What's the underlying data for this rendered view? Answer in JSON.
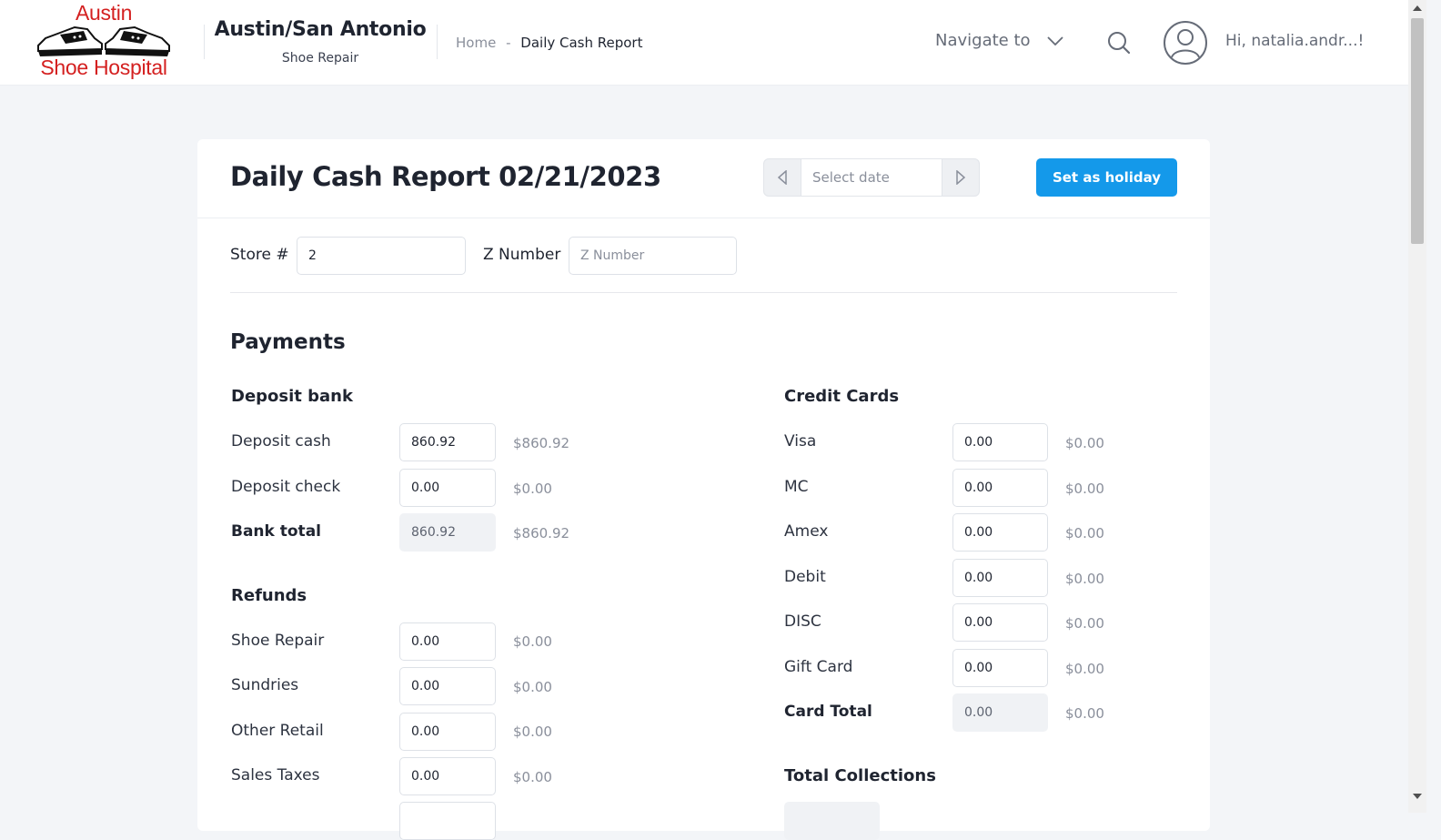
{
  "header": {
    "logo": {
      "line1": "Austin",
      "line2": "Shoe Hospital"
    },
    "brand_title": "Austin/San Antonio",
    "brand_subtitle": "Shoe Repair",
    "breadcrumb": {
      "home": "Home",
      "separator": "-",
      "current": "Daily Cash Report"
    },
    "navigate_label": "Navigate to",
    "greeting": "Hi, natalia.andr...!"
  },
  "report": {
    "title": "Daily Cash Report 02/21/2023",
    "date_placeholder": "Select date",
    "holiday_button": "Set as holiday",
    "store_label": "Store #",
    "store_value": "2",
    "z_label": "Z Number",
    "z_placeholder": "Z Number"
  },
  "payments": {
    "title": "Payments",
    "deposit_bank": {
      "title": "Deposit bank",
      "rows": [
        {
          "label": "Deposit cash",
          "value": "860.92",
          "amount": "$860.92"
        },
        {
          "label": "Deposit check",
          "value": "0.00",
          "amount": "$0.00"
        },
        {
          "label": "Bank total",
          "value": "860.92",
          "amount": "$860.92"
        }
      ]
    },
    "refunds": {
      "title": "Refunds",
      "rows": [
        {
          "label": "Shoe Repair",
          "value": "0.00",
          "amount": "$0.00"
        },
        {
          "label": "Sundries",
          "value": "0.00",
          "amount": "$0.00"
        },
        {
          "label": "Other Retail",
          "value": "0.00",
          "amount": "$0.00"
        },
        {
          "label": "Sales Taxes",
          "value": "0.00",
          "amount": "$0.00"
        }
      ]
    },
    "credit_cards": {
      "title": "Credit Cards",
      "rows": [
        {
          "label": "Visa",
          "value": "0.00",
          "amount": "$0.00"
        },
        {
          "label": "MC",
          "value": "0.00",
          "amount": "$0.00"
        },
        {
          "label": "Amex",
          "value": "0.00",
          "amount": "$0.00"
        },
        {
          "label": "Debit",
          "value": "0.00",
          "amount": "$0.00"
        },
        {
          "label": "DISC",
          "value": "0.00",
          "amount": "$0.00"
        },
        {
          "label": "Gift Card",
          "value": "0.00",
          "amount": "$0.00"
        },
        {
          "label": "Card Total",
          "value": "0.00",
          "amount": "$0.00"
        }
      ]
    },
    "total_collections": {
      "title": "Total Collections"
    }
  },
  "colors": {
    "accent": "#1499ea",
    "logo_red": "#d42020",
    "page_bg": "#f3f5f8",
    "text_dark": "#1f2430",
    "text_muted": "#8a8f9b"
  },
  "icons": {
    "logo": "sneakers-logo",
    "navigate": "chevron-down-icon",
    "search": "search-icon",
    "avatar": "user-circle-icon",
    "prev_date": "triangle-left-icon",
    "next_date": "triangle-right-icon"
  }
}
